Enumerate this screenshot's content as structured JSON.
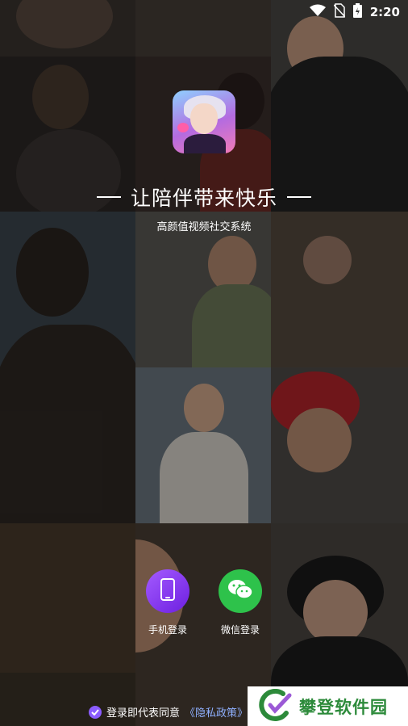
{
  "status_bar": {
    "time": "2:20"
  },
  "headline": {
    "text": "让陪伴带来快乐"
  },
  "subtitle": "高颜值视频社交系统",
  "login": {
    "phone_label": "手机登录",
    "wechat_label": "微信登录"
  },
  "privacy": {
    "prefix": "登录即代表同意",
    "link": "《隐私政策》"
  },
  "watermark": {
    "text": "攀登软件园"
  },
  "colors": {
    "phone_button": "#7b2cf0",
    "wechat_button": "#2ec24b",
    "policy_link": "#8fb0ff",
    "watermark_text": "#2c8a3a"
  },
  "icons": [
    "wifi-icon",
    "no-sim-icon",
    "battery-icon",
    "phone-icon",
    "wechat-icon",
    "checkbox-checked-icon"
  ]
}
